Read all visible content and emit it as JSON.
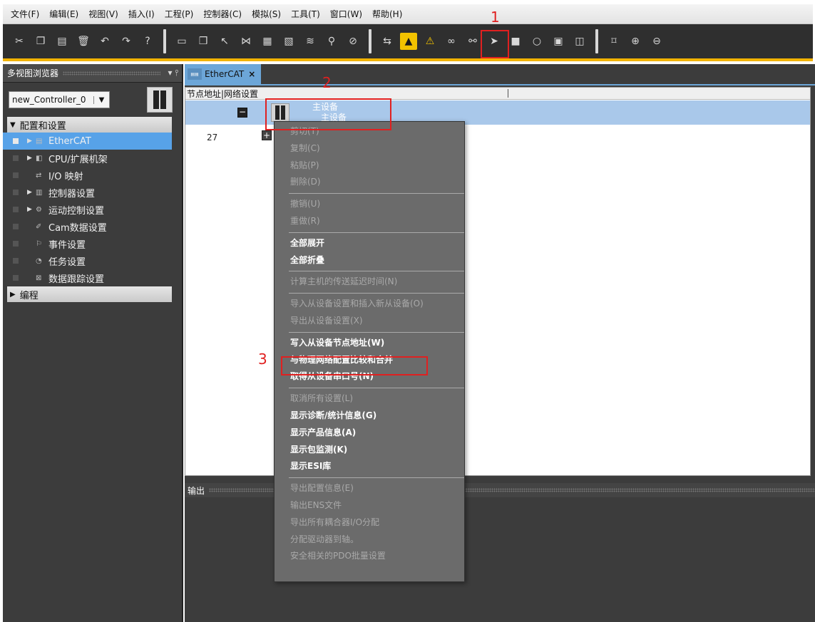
{
  "menu": [
    "文件(F)",
    "编辑(E)",
    "视图(V)",
    "插入(I)",
    "工程(P)",
    "控制器(C)",
    "模拟(S)",
    "工具(T)",
    "窗口(W)",
    "帮助(H)"
  ],
  "left_pane": {
    "title": "多视图浏览器",
    "pin": "↓ ∙",
    "controller": "new_Controller_0",
    "config_section": "配置和设置",
    "items": [
      "EtherCAT",
      "CPU/扩展机架",
      "I/O 映射",
      "控制器设置",
      "运动控制设置",
      "Cam数据设置",
      "事件设置",
      "任务设置",
      "数据跟踪设置"
    ],
    "programming_section": "编程"
  },
  "editor": {
    "tab_label": "EtherCAT",
    "tab_close": "×",
    "header_col1": "节点地址|网络设置",
    "master_label": "主设备",
    "master_sub": "主设备",
    "node_address": "27",
    "output_title": "输出"
  },
  "context_menu": {
    "group1": [
      "剪切(T)",
      "复制(C)",
      "粘贴(P)",
      "删除(D)"
    ],
    "group2": [
      "撤销(U)",
      "重做(R)"
    ],
    "group3": [
      "全部展开",
      "全部折叠"
    ],
    "group4": [
      "计算主机的传送延迟时间(N)"
    ],
    "group5": [
      "导入从设备设置和插入新从设备(O)",
      "导出从设备设置(X)"
    ],
    "group6": [
      "写入从设备节点地址(W)",
      "与物理网络配置比较和合并",
      "取得从设备串口号(N)"
    ],
    "group7": [
      "取消所有设置(L)",
      "显示诊断/统计信息(G)",
      "显示产品信息(A)",
      "显示包监测(K)",
      "显示ESI库"
    ],
    "group8": [
      "导出配置信息(E)",
      "输出ENS文件",
      "导出所有耦合器I/O分配",
      "分配驱动器到轴。",
      "安全相关的PDO批量设置"
    ]
  },
  "annotations": [
    "1",
    "2",
    "3"
  ]
}
